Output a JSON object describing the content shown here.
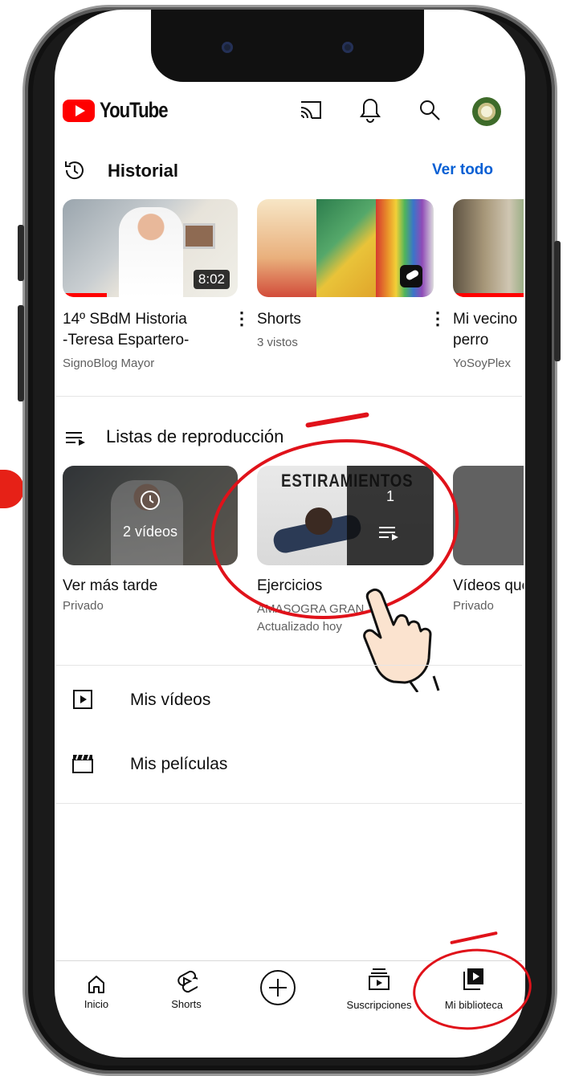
{
  "header": {
    "app_name": "YouTube",
    "icons": [
      "cast-icon",
      "bell-icon",
      "search-icon",
      "avatar"
    ]
  },
  "history": {
    "title": "Historial",
    "see_all": "Ver todo",
    "videos": [
      {
        "title_line1": "14º SBdM Historia",
        "title_line2": "-Teresa Espartero-",
        "channel": "SignoBlog Mayor",
        "duration": "8:02",
        "progress": 0.25
      },
      {
        "title_line1": "Shorts",
        "title_line2": "",
        "channel": "3 vistos",
        "duration": "",
        "progress": 0
      },
      {
        "title_line1": "Mi vecino",
        "title_line2": "perro",
        "channel": "YoSoyPlex",
        "duration": "",
        "progress": 1.0
      }
    ]
  },
  "playlists": {
    "title": "Listas de reproducción",
    "items": [
      {
        "title": "Ver más tarde",
        "sub1": "Privado",
        "sub2": "",
        "overlay": "2 vídeos"
      },
      {
        "title": "Ejercicios",
        "sub1": "AMASOGRA GRAN",
        "sub2": "Actualizado hoy",
        "overlay": "1",
        "thumb_text": "ESTIRAMIENTOS"
      },
      {
        "title": "Vídeos que",
        "sub1": "Privado",
        "sub2": "",
        "overlay": ""
      }
    ]
  },
  "library_rows": [
    {
      "label": "Mis vídeos",
      "icon": "play-box-icon"
    },
    {
      "label": "Mis películas",
      "icon": "clapperboard-icon"
    }
  ],
  "bottom_nav": [
    {
      "label": "Inicio",
      "icon": "home-icon"
    },
    {
      "label": "Shorts",
      "icon": "shorts-icon"
    },
    {
      "label": "",
      "icon": "create-plus-icon"
    },
    {
      "label": "Suscripciones",
      "icon": "subscriptions-icon"
    },
    {
      "label": "Mi biblioteca",
      "icon": "library-icon",
      "active": true
    }
  ],
  "colors": {
    "brand_red": "#ff0000",
    "link_blue": "#065fd4",
    "annotation_red": "#e0121a"
  }
}
